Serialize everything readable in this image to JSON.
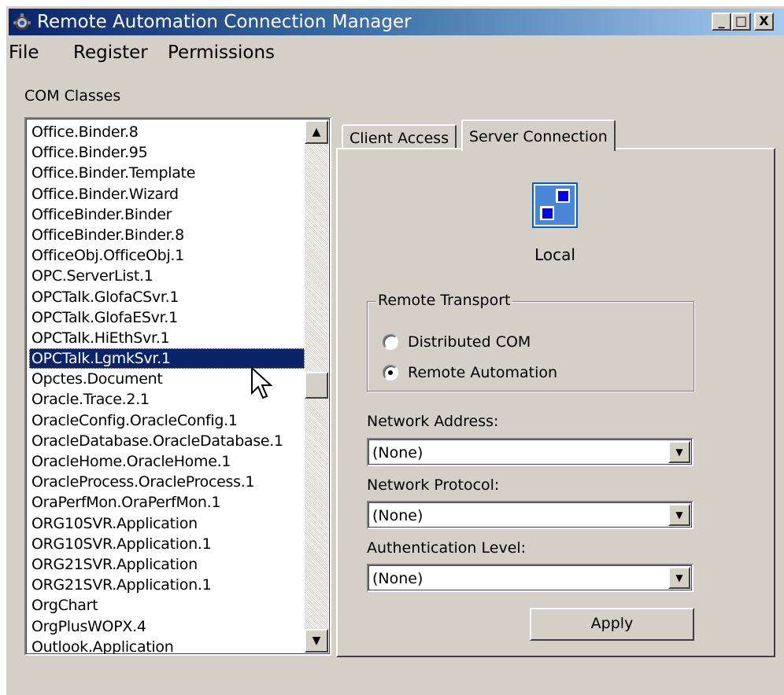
{
  "window": {
    "title": "Remote Automation Connection Manager",
    "minimize_label": "_",
    "maximize_label": "□",
    "close_label": "X"
  },
  "menu": {
    "file": "File",
    "register": "Register",
    "permissions": "Permissions"
  },
  "com_classes": {
    "label": "COM Classes",
    "items": [
      "Office.Binder.8",
      "Office.Binder.95",
      "Office.Binder.Template",
      "Office.Binder.Wizard",
      "OfficeBinder.Binder",
      "OfficeBinder.Binder.8",
      "OfficeObj.OfficeObj.1",
      "OPC.ServerList.1",
      "OPCTalk.GlofaCSvr.1",
      "OPCTalk.GlofaESvr.1",
      "OPCTalk.HiEthSvr.1",
      "OPCTalk.LgmkSvr.1",
      "Opctes.Document",
      "Oracle.Trace.2.1",
      "OracleConfig.OracleConfig.1",
      "OracleDatabase.OracleDatabase.1",
      "OracleHome.OracleHome.1",
      "OracleProcess.OracleProcess.1",
      "OraPerfMon.OraPerfMon.1",
      "ORG10SVR.Application",
      "ORG10SVR.Application.1",
      "ORG21SVR.Application",
      "ORG21SVR.Application.1",
      "OrgChart",
      "OrgPlusWOPX.4",
      "Outlook.Application"
    ],
    "selected": "OPCTalk.LgmkSvr.1"
  },
  "tabs": {
    "client_access": "Client Access",
    "server_connection": "Server Connection",
    "active": "Server Connection"
  },
  "server_connection": {
    "status_label": "Local",
    "status_icon": "local-server-icon",
    "remote_transport": {
      "legend": "Remote Transport",
      "option_dcom": "Distributed COM",
      "option_ra": "Remote Automation",
      "selected": "Remote Automation"
    },
    "network_address": {
      "label": "Network Address:",
      "value": "(None)"
    },
    "network_protocol": {
      "label": "Network Protocol:",
      "value": "(None)"
    },
    "authentication_level": {
      "label": "Authentication Level:",
      "value": "(None)"
    },
    "apply_label": "Apply"
  },
  "colors": {
    "face": "#d4d0c8",
    "title_start": "#0a246a",
    "title_end": "#a6caf0",
    "selection": "#0a246a"
  }
}
